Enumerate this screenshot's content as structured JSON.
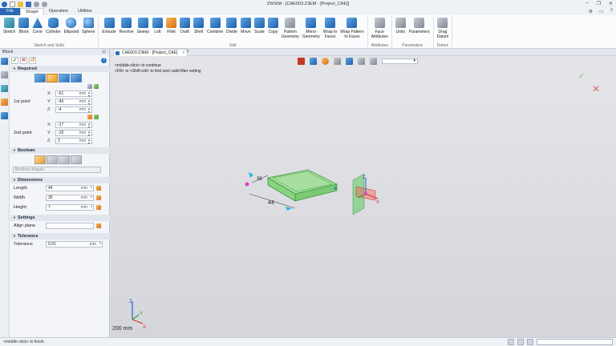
{
  "window": {
    "title": "ZWSIM - [CAE003.Z3EM - [Project_CAE]]",
    "minimize": "–",
    "restore": "❐",
    "close": "✕"
  },
  "tabs": [
    "File",
    "Shape",
    "Operation",
    "Utilities"
  ],
  "ribbon": {
    "groups": [
      {
        "label": "Sketch and Solid",
        "tools": [
          "Sketch",
          "Block",
          "Cone",
          "Cylinder",
          "Ellipsoid",
          "Sphere"
        ]
      },
      {
        "label": "Edit",
        "tools": [
          "Extrude",
          "Revolve",
          "Sweep",
          "Loft",
          "Fillet",
          "Draft",
          "Shell",
          "Combine",
          "Divide",
          "Move",
          "Scale",
          "Copy",
          "Pattern\nGeometry",
          "Mirror\nGeometry",
          "Wrap to\nFaces",
          "Wrap Pattern\nto Faces"
        ]
      },
      {
        "label": "Attributes",
        "tools": [
          "Face\nAttributes"
        ]
      },
      {
        "label": "Parameters",
        "tools": [
          "Units",
          "Parameters"
        ]
      },
      {
        "label": "Datum",
        "tools": [
          "Drag\nDatum"
        ]
      }
    ]
  },
  "panel": {
    "title": "Block",
    "pin": "⊟",
    "help": "?",
    "required": "Required",
    "point1": {
      "label": "1st point",
      "x": "-61",
      "y": "-45",
      "z": "-4"
    },
    "point2": {
      "label": "2nd point",
      "x": "-17",
      "y": "-10",
      "z": "3"
    },
    "axes": {
      "x": "X:",
      "y": "Y:",
      "z": "Z:"
    },
    "unit": "mm",
    "boolean": "Boolean",
    "boolean_shapes": "Boolean shapes",
    "dimensions": "Dimensions",
    "length_label": "Length",
    "length": "44",
    "width_label": "Width",
    "width": "35",
    "height_label": "Height",
    "height": "7",
    "settings": "Settings",
    "align_plane": "Align plane",
    "tolerance_section": "Tolerance",
    "tolerance_label": "Tolerance",
    "tolerance": "0.01"
  },
  "doc_tab": "CAE003.Z3EM - [Project_CAE]",
  "doc_tab_add": "+",
  "viewport": {
    "hint_line1": "<middle-click> to continue",
    "hint_line2": "<F8> or <Shift-roll> to find next valid filter setting",
    "dim_44": "44",
    "dim_35": "35",
    "scale": "200 mm",
    "axis_x": "X",
    "axis_y": "Y",
    "axis_z": "Z"
  },
  "status": "<middle-click> to finish."
}
